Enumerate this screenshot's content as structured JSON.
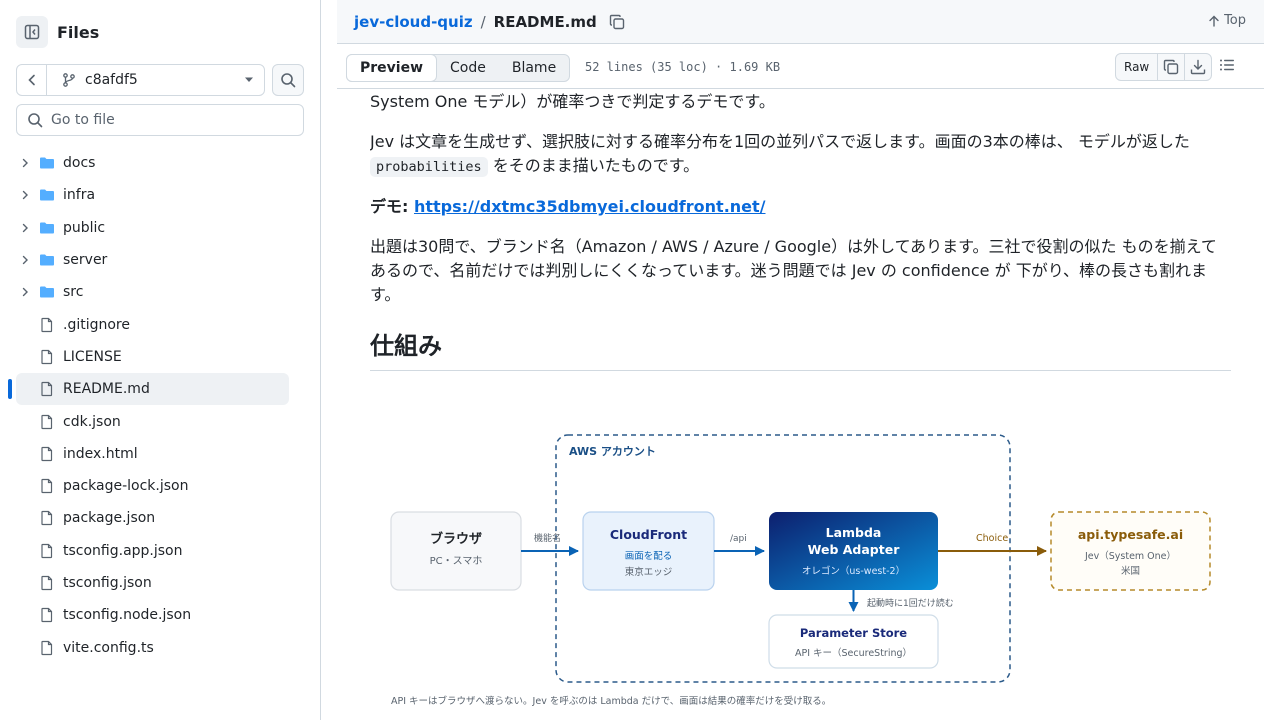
{
  "sidebar": {
    "title": "Files",
    "branch": "c8afdf5",
    "goto_placeholder": "Go to file",
    "items": [
      {
        "type": "folder",
        "label": "docs"
      },
      {
        "type": "folder",
        "label": "infra"
      },
      {
        "type": "folder",
        "label": "public"
      },
      {
        "type": "folder",
        "label": "server"
      },
      {
        "type": "folder",
        "label": "src"
      },
      {
        "type": "file",
        "label": ".gitignore"
      },
      {
        "type": "file",
        "label": "LICENSE"
      },
      {
        "type": "file",
        "label": "README.md",
        "active": true
      },
      {
        "type": "file",
        "label": "cdk.json"
      },
      {
        "type": "file",
        "label": "index.html"
      },
      {
        "type": "file",
        "label": "package-lock.json"
      },
      {
        "type": "file",
        "label": "package.json"
      },
      {
        "type": "file",
        "label": "tsconfig.app.json"
      },
      {
        "type": "file",
        "label": "tsconfig.json"
      },
      {
        "type": "file",
        "label": "tsconfig.node.json"
      },
      {
        "type": "file",
        "label": "vite.config.ts"
      }
    ]
  },
  "breadcrumb": {
    "repo": "jev-cloud-quiz",
    "sep": "/",
    "file": "README.md",
    "top": "Top"
  },
  "toolbar": {
    "tabs": [
      "Preview",
      "Code",
      "Blame"
    ],
    "meta": "52 lines (35 loc) · 1.69 KB",
    "raw": "Raw"
  },
  "readme": {
    "intro_tail": "System One モデル）が確率つきで判定するデモです。",
    "para1_a": "Jev は文章を生成せず、選択肢に対する確率分布を1回の並列パスで返します。画面の3本の棒は、 モデルが返した",
    "para1_code": "probabilities",
    "para1_b": " をそのまま描いたものです。",
    "demo_label": "デモ: ",
    "demo_url": "https://dxtmc35dbmyei.cloudfront.net/",
    "para2": "出題は30問で、ブランド名（Amazon / AWS / Azure / Google）は外してあります。三社で役割の似た ものを揃えてあるので、名前だけでは判別しにくくなっています。迷う問題では Jev の confidence が 下がり、棒の長さも割れます。",
    "heading": "仕組み"
  },
  "diagram": {
    "aws_label": "AWS アカウント",
    "browser": {
      "title": "ブラウザ",
      "sub": "PC・スマホ"
    },
    "edge1": "機能名",
    "cloudfront": {
      "title": "CloudFront",
      "sub1": "画面を配る",
      "sub2": "東京エッジ"
    },
    "edge2": "/api",
    "lambda": {
      "title1": "Lambda",
      "title2": "Web Adapter",
      "sub": "オレゴン（us-west-2）"
    },
    "edge3": "Choice",
    "api": {
      "title": "api.typesafe.ai",
      "sub1": "Jev（System One）",
      "sub2": "米国"
    },
    "edge4": "起動時に1回だけ読む",
    "param": {
      "title": "Parameter Store",
      "sub": "API キー（SecureString）"
    },
    "caption": "API キーはブラウザへ渡らない。Jev を呼ぶのは Lambda だけで、画面は結果の確率だけを受け取る。",
    "colors": {
      "dark_blue": "#1a2a7a",
      "accent_blue": "#0a63b5",
      "orange": "#9a6a12"
    }
  }
}
